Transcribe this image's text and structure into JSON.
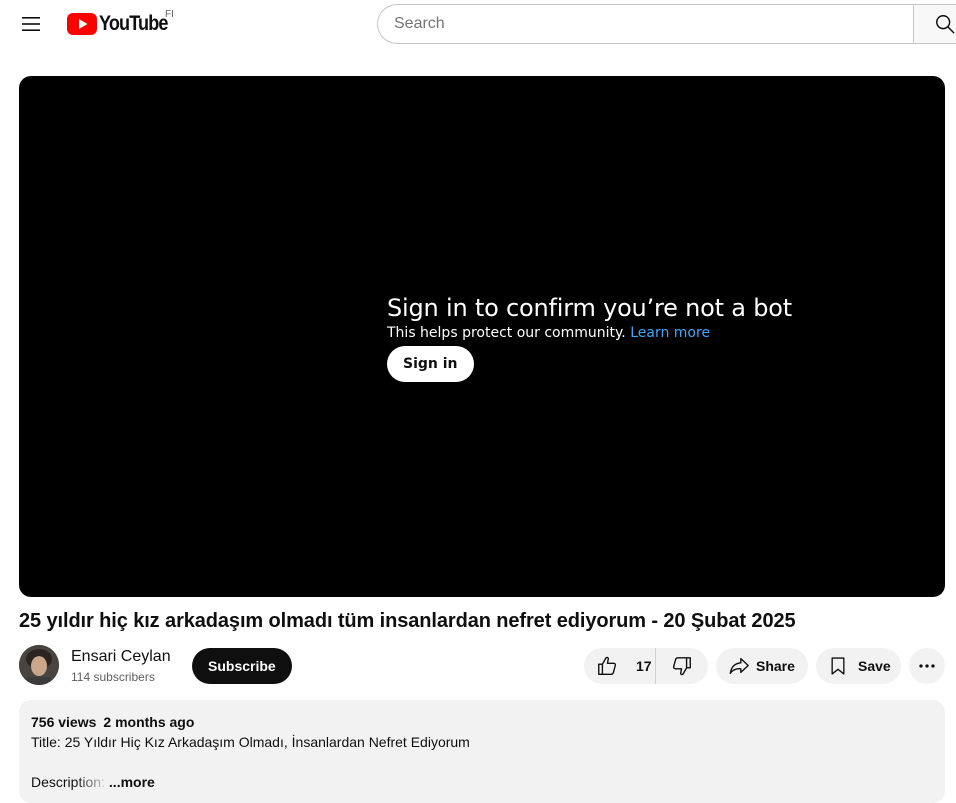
{
  "header": {
    "logo_text": "YouTube",
    "country_code": "FI",
    "search_placeholder": "Search"
  },
  "player": {
    "heading": "Sign in to confirm you’re not a bot",
    "subtext": "This helps protect our community.",
    "learn_more": "Learn more",
    "sign_in_label": "Sign in"
  },
  "video": {
    "title": "25 yıldır hiç kız arkadaşım olmadı tüm insanlardan nefret ediyorum - 20 Şubat 2025"
  },
  "channel": {
    "name": "Ensari Ceylan",
    "subscribers": "114 subscribers",
    "subscribe_label": "Subscribe"
  },
  "actions": {
    "like_count": "17",
    "share_label": "Share",
    "save_label": "Save"
  },
  "description": {
    "views": "756 views",
    "date": "2 months ago",
    "line1": "Title: 25 Yıldır Hiç Kız Arkadaşım Olmadı, İnsanlardan Nefret Ediyorum",
    "line2_prefix": "Description:",
    "more_label": "...more"
  },
  "colors": {
    "brand_red": "#ff0000",
    "link_blue": "#3ea6ff",
    "pill_bg": "#f2f2f2"
  }
}
